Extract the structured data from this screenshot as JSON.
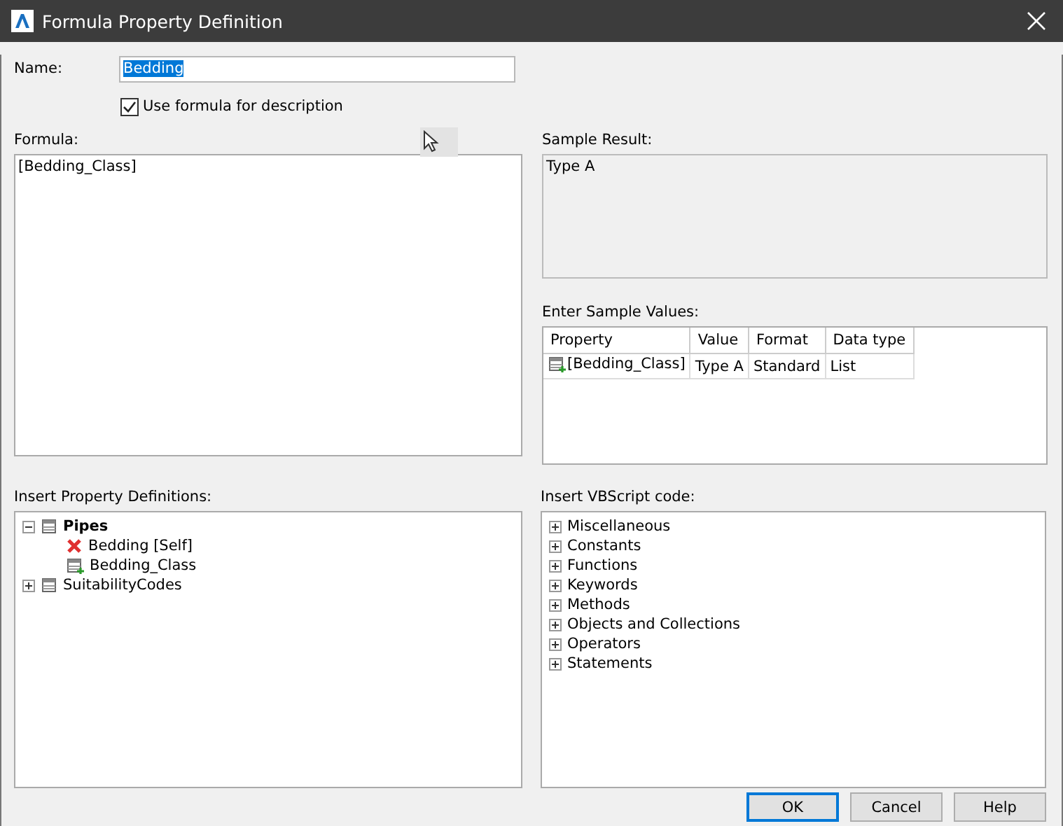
{
  "window": {
    "title": "Formula Property Definition"
  },
  "name": {
    "label": "Name:",
    "value": "Bedding",
    "selected": true
  },
  "use_formula": {
    "label": "Use formula for description",
    "checked": true
  },
  "formula": {
    "label": "Formula:",
    "value": "[Bedding_Class]"
  },
  "sample_result": {
    "label": "Sample Result:",
    "value": "Type A"
  },
  "sample_values": {
    "label": "Enter Sample Values:",
    "columns": [
      "Property",
      "Value",
      "Format",
      "Data type"
    ],
    "rows": [
      {
        "property": "[Bedding_Class]",
        "value": "Type A",
        "format": "Standard",
        "data_type": "List"
      }
    ]
  },
  "property_definitions": {
    "label": "Insert Property Definitions:",
    "items": [
      {
        "label": "Pipes",
        "kind": "group",
        "bold": true,
        "expanded": true,
        "children": [
          {
            "label": "Bedding [Self]",
            "kind": "error"
          },
          {
            "label": "Bedding_Class",
            "kind": "property"
          }
        ]
      },
      {
        "label": "SuitabilityCodes",
        "kind": "group",
        "bold": false,
        "expanded": false
      }
    ]
  },
  "vbscript": {
    "label": "Insert VBScript code:",
    "items": [
      {
        "label": "Miscellaneous",
        "expanded": false
      },
      {
        "label": "Constants",
        "expanded": false
      },
      {
        "label": "Functions",
        "expanded": false
      },
      {
        "label": "Keywords",
        "expanded": false
      },
      {
        "label": "Methods",
        "expanded": false
      },
      {
        "label": "Objects and Collections",
        "expanded": false
      },
      {
        "label": "Operators",
        "expanded": false
      },
      {
        "label": "Statements",
        "expanded": false
      }
    ]
  },
  "buttons": [
    {
      "label": "OK",
      "default": true
    },
    {
      "label": "Cancel",
      "default": false
    },
    {
      "label": "Help",
      "default": false
    }
  ]
}
